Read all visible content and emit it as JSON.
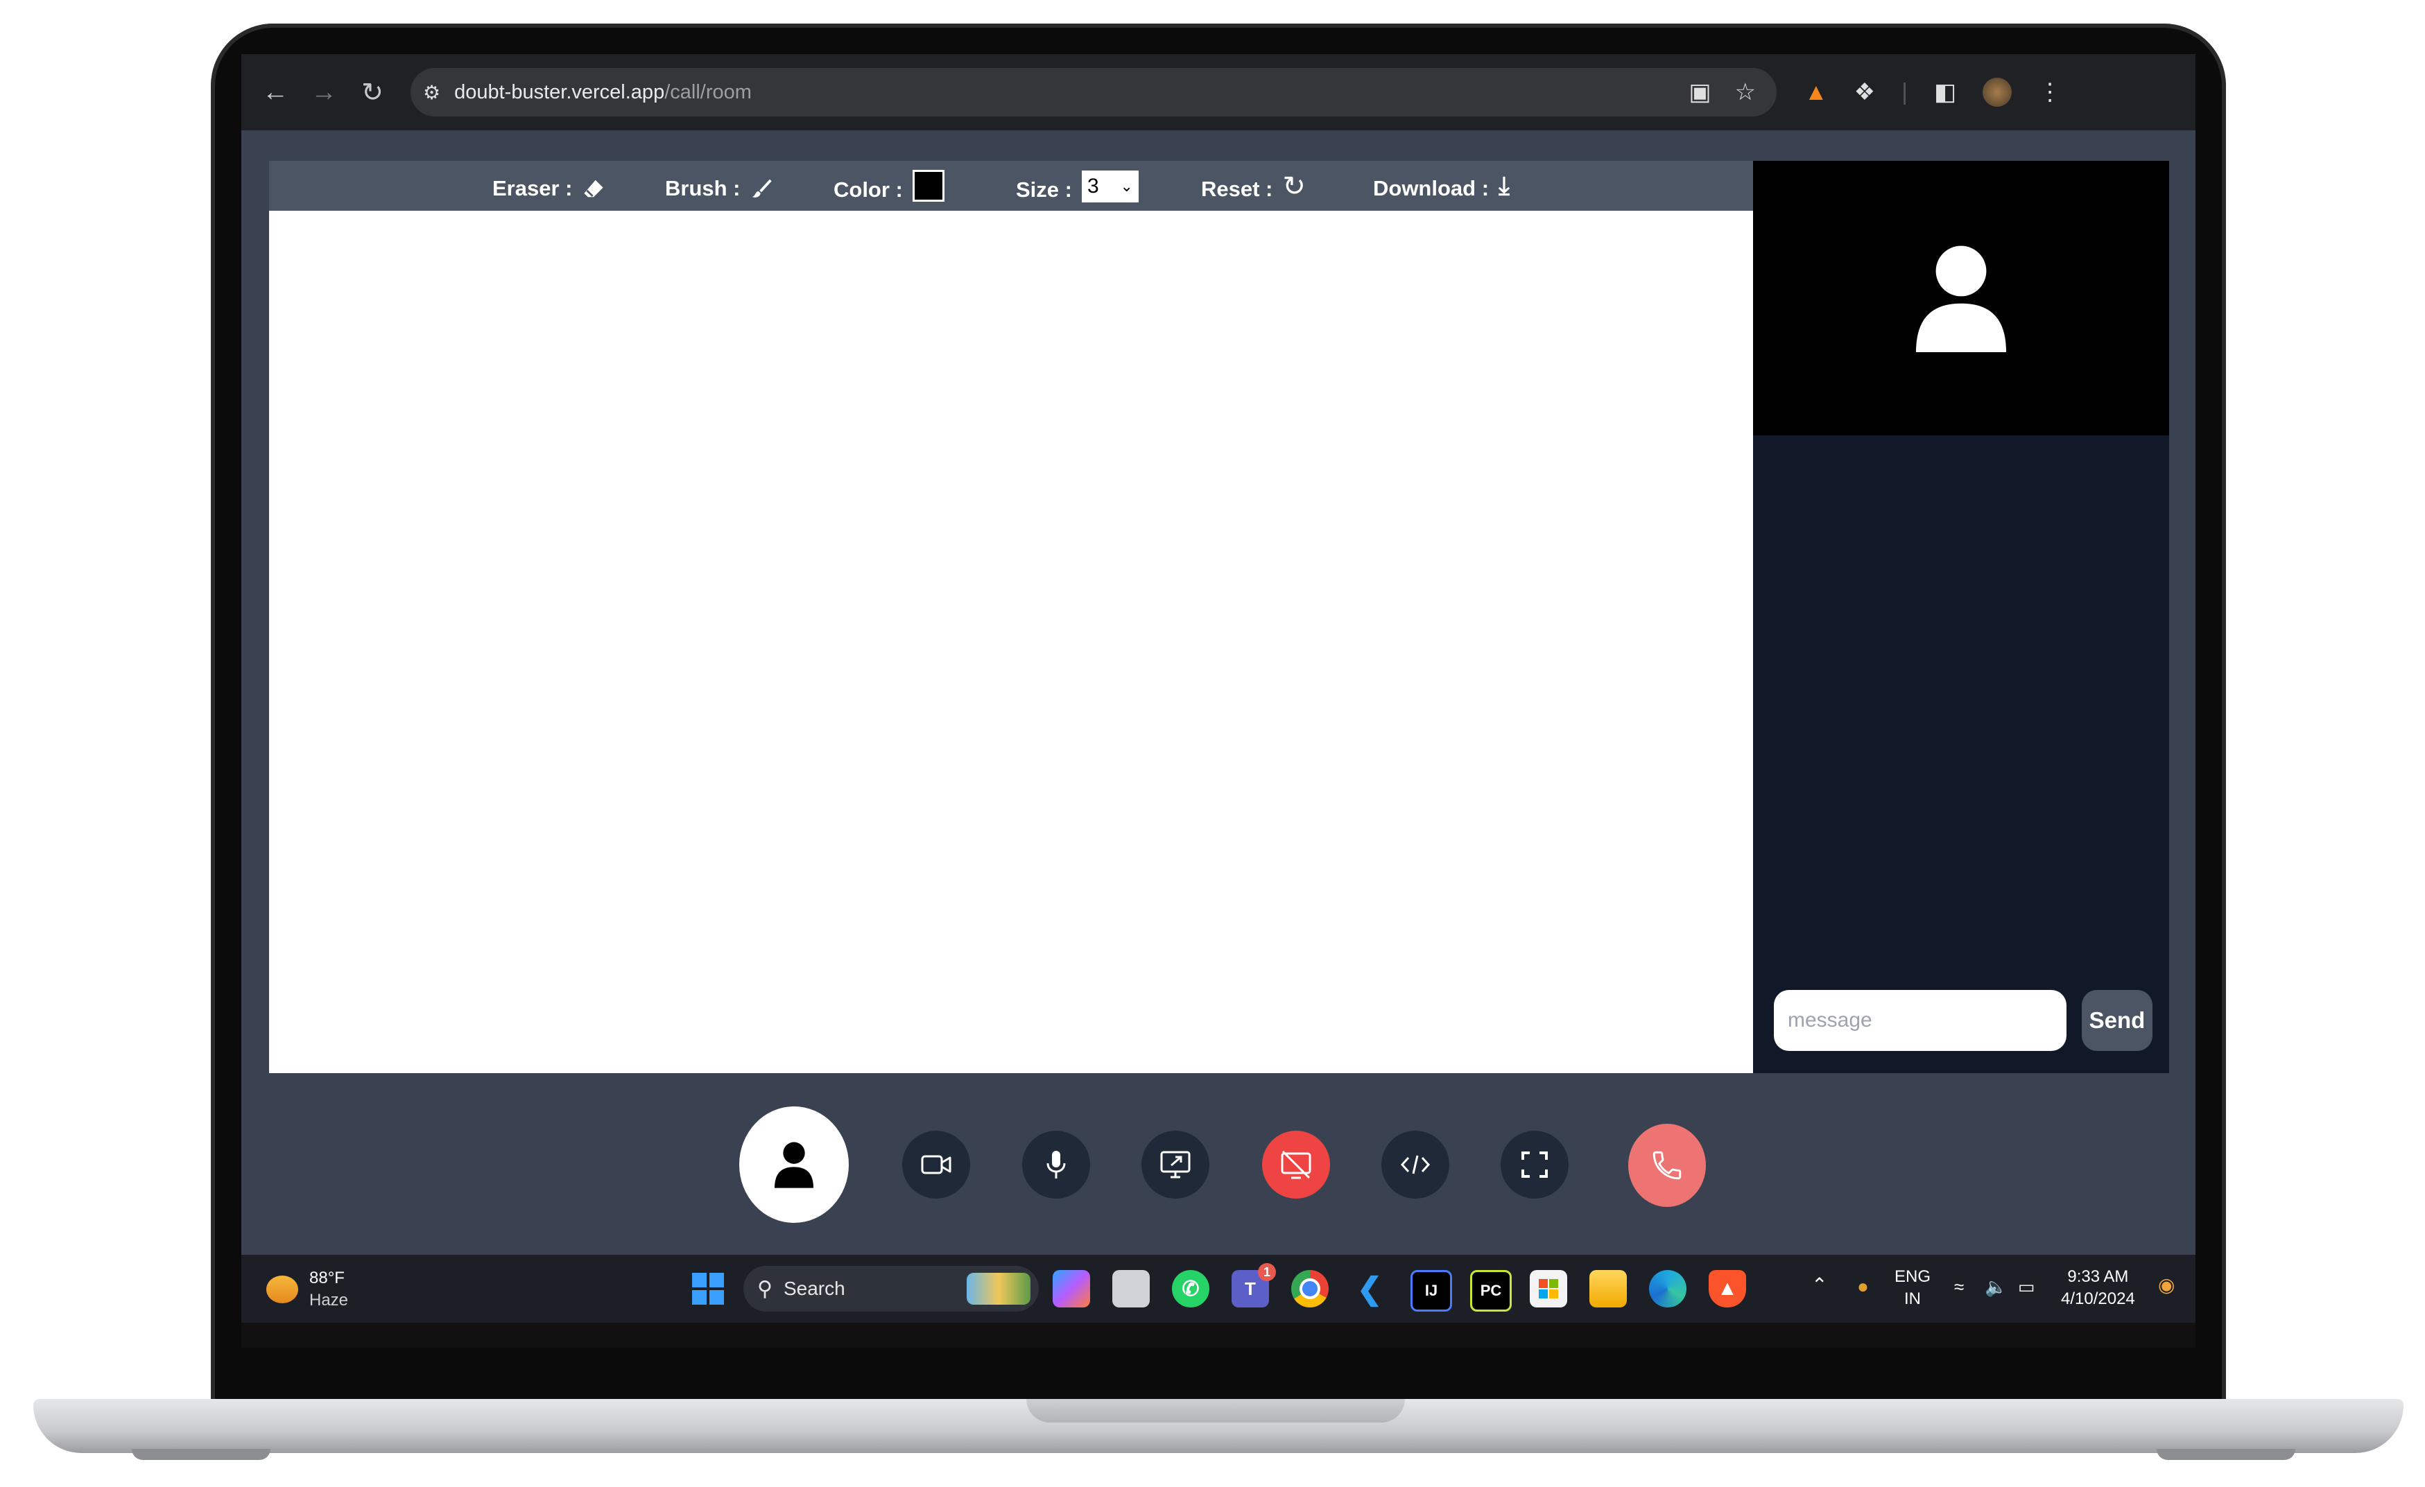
{
  "browser": {
    "url_host": "doubt-buster.vercel.app",
    "url_path": "/call/room"
  },
  "toolbar": {
    "eraser_label": "Eraser :",
    "brush_label": "Brush :",
    "color_label": "Color :",
    "color_value": "#000000",
    "size_label": "Size :",
    "size_value": "3",
    "reset_label": "Reset :",
    "download_label": "Download :"
  },
  "chat": {
    "placeholder": "message",
    "send_label": "Send"
  },
  "controls": [
    {
      "name": "participants-button",
      "icon": "user-icon"
    },
    {
      "name": "camera-button",
      "icon": "video-camera-icon"
    },
    {
      "name": "mic-button",
      "icon": "microphone-icon"
    },
    {
      "name": "share-screen-button",
      "icon": "screen-share-icon"
    },
    {
      "name": "stop-share-button",
      "icon": "screen-off-icon",
      "color": "#ef4444"
    },
    {
      "name": "code-editor-button",
      "icon": "code-icon"
    },
    {
      "name": "fullscreen-button",
      "icon": "fullscreen-icon"
    },
    {
      "name": "end-call-button",
      "icon": "phone-hangup-icon",
      "color": "#ee7373"
    }
  ],
  "taskbar": {
    "weather_temp": "88°F",
    "weather_desc": "Haze",
    "search_label": "Search",
    "teams_badge": "1",
    "lang_line1": "ENG",
    "lang_line2": "IN",
    "time": "9:33 AM",
    "date": "4/10/2024"
  }
}
